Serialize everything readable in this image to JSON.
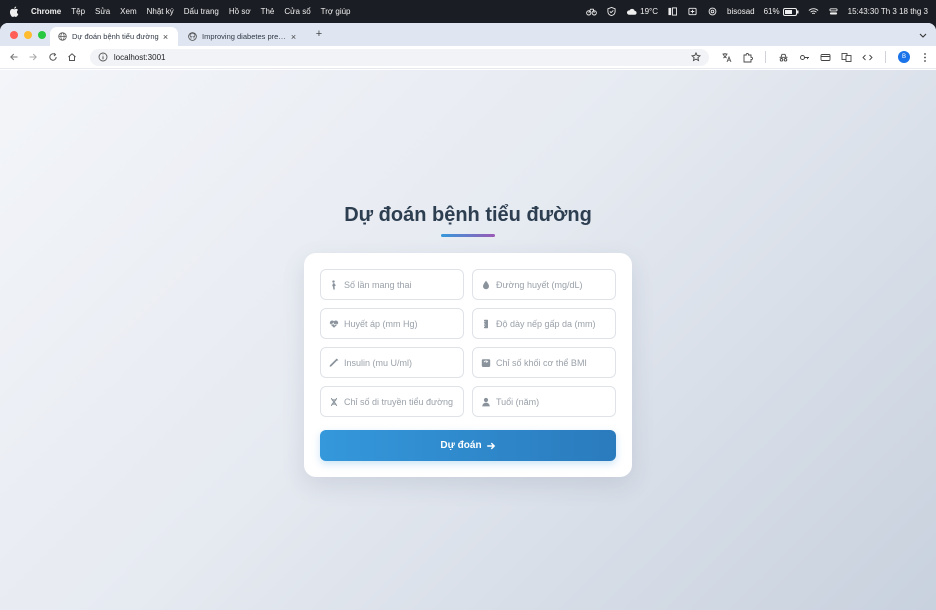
{
  "menubar": {
    "app": "Chrome",
    "items": [
      "Tệp",
      "Sửa",
      "Xem",
      "Nhật ký",
      "Dấu trang",
      "Hồ sơ",
      "Thẻ",
      "Cửa sổ",
      "Trợ giúp"
    ],
    "weather": "19°C",
    "user": "bisosad",
    "battery": "61%",
    "clock": "15:43:30 Th 3 18 thg 3"
  },
  "tabs": [
    {
      "title": "Dự đoán bệnh tiểu đường",
      "active": true
    },
    {
      "title": "Improving diabetes prediction",
      "active": false
    }
  ],
  "toolbar": {
    "url": "localhost:3001",
    "profile_initial": "B"
  },
  "page": {
    "title": "Dự đoán bệnh tiểu đường",
    "fields": [
      {
        "placeholder": "Số lần mang thai",
        "icon": "pregnant-icon"
      },
      {
        "placeholder": "Đường huyết (mg/dL)",
        "icon": "droplet-icon"
      },
      {
        "placeholder": "Huyết áp (mm Hg)",
        "icon": "heart-pulse-icon"
      },
      {
        "placeholder": "Độ dày nếp gấp da (mm)",
        "icon": "ruler-icon"
      },
      {
        "placeholder": "Insulin (mu U/ml)",
        "icon": "syringe-icon"
      },
      {
        "placeholder": "Chỉ số khối cơ thể BMI",
        "icon": "scale-icon"
      },
      {
        "placeholder": "Chỉ số di truyền tiểu đường",
        "icon": "dna-icon"
      },
      {
        "placeholder": "Tuổi (năm)",
        "icon": "user-icon"
      }
    ],
    "submit_label": "Dự đoán",
    "colors": {
      "accent": "#3498db",
      "heading": "#2c3e50",
      "underline_end": "#9b59b6"
    }
  }
}
